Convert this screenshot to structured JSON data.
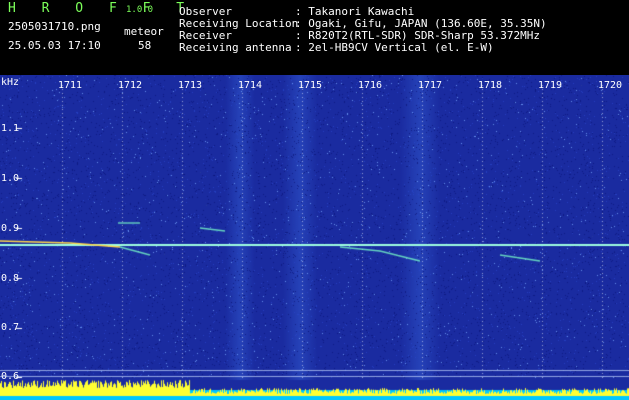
{
  "header": {
    "app_title": "H R O F F T",
    "app_version": "1.0.0",
    "file_name": "2505031710.png",
    "datetime": "25.05.03 17:10",
    "meteor_label": "meteor",
    "meteor_count": "58",
    "info_rows": [
      {
        "label": "Observer",
        "value": ": Takanori Kawachi"
      },
      {
        "label": "Receiving Location",
        "value": ": Ogaki, Gifu, JAPAN (136.60E, 35.35N)"
      },
      {
        "label": "Receiver",
        "value": ": R820T2(RTL-SDR) SDR-Sharp 53.372MHz"
      },
      {
        "label": "Receiving antenna",
        "value": ": 2el-HB9CV Vertical (el. E-W)"
      }
    ]
  },
  "axis": {
    "y_unit": "kHz",
    "y_ticks": [
      "1.1",
      "1.0",
      "0.9",
      "0.8",
      "0.7",
      "0.6"
    ],
    "x_ticks": [
      "1711",
      "1712",
      "1713",
      "1714",
      "1715",
      "1716",
      "1717",
      "1718",
      "1719",
      "1720"
    ]
  },
  "colors": {
    "background": "#000000",
    "waterfall_base": "#1a2ba0",
    "signal_line": "#9fffe0",
    "meteor_trace": "#ffd84a",
    "level_bar": "#ffff33",
    "level_base": "#00c8ff",
    "title_green": "#7cff5a"
  }
}
